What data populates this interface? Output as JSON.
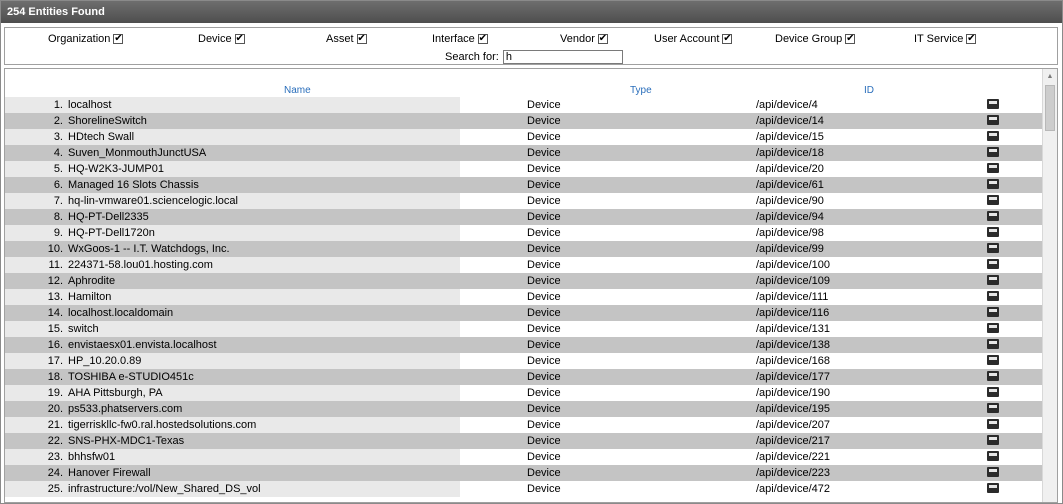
{
  "panel": {
    "title": "254 Entities Found"
  },
  "filters": [
    {
      "label": "Organization",
      "checked": true
    },
    {
      "label": "Device",
      "checked": true
    },
    {
      "label": "Asset",
      "checked": true
    },
    {
      "label": "Interface",
      "checked": true
    },
    {
      "label": "Vendor",
      "checked": true
    },
    {
      "label": "User Account",
      "checked": true
    },
    {
      "label": "Device Group",
      "checked": true
    },
    {
      "label": "IT Service",
      "checked": true
    }
  ],
  "check_glyph": "✔",
  "search": {
    "label": "Search for:",
    "value": "h"
  },
  "table": {
    "columns": {
      "name": "Name",
      "type": "Type",
      "id": "ID"
    },
    "rows": [
      {
        "num": "1.",
        "name": "localhost",
        "type": "Device",
        "id": "/api/device/4"
      },
      {
        "num": "2.",
        "name": "ShorelineSwitch",
        "type": "Device",
        "id": "/api/device/14"
      },
      {
        "num": "3.",
        "name": "HDtech Swall",
        "type": "Device",
        "id": "/api/device/15"
      },
      {
        "num": "4.",
        "name": "Suven_MonmouthJunctUSA",
        "type": "Device",
        "id": "/api/device/18"
      },
      {
        "num": "5.",
        "name": "HQ-W2K3-JUMP01",
        "type": "Device",
        "id": "/api/device/20"
      },
      {
        "num": "6.",
        "name": "Managed 16 Slots Chassis",
        "type": "Device",
        "id": "/api/device/61"
      },
      {
        "num": "7.",
        "name": "hq-lin-vmware01.sciencelogic.local",
        "type": "Device",
        "id": "/api/device/90"
      },
      {
        "num": "8.",
        "name": "HQ-PT-Dell2335",
        "type": "Device",
        "id": "/api/device/94"
      },
      {
        "num": "9.",
        "name": "HQ-PT-Dell1720n",
        "type": "Device",
        "id": "/api/device/98"
      },
      {
        "num": "10.",
        "name": "WxGoos-1 -- I.T. Watchdogs, Inc.",
        "type": "Device",
        "id": "/api/device/99"
      },
      {
        "num": "11.",
        "name": "224371-58.lou01.hosting.com",
        "type": "Device",
        "id": "/api/device/100"
      },
      {
        "num": "12.",
        "name": "Aphrodite",
        "type": "Device",
        "id": "/api/device/109"
      },
      {
        "num": "13.",
        "name": "Hamilton",
        "type": "Device",
        "id": "/api/device/111"
      },
      {
        "num": "14.",
        "name": "localhost.localdomain",
        "type": "Device",
        "id": "/api/device/116"
      },
      {
        "num": "15.",
        "name": "switch",
        "type": "Device",
        "id": "/api/device/131"
      },
      {
        "num": "16.",
        "name": "envistaesx01.envista.localhost",
        "type": "Device",
        "id": "/api/device/138"
      },
      {
        "num": "17.",
        "name": "HP_10.20.0.89",
        "type": "Device",
        "id": "/api/device/168"
      },
      {
        "num": "18.",
        "name": "TOSHIBA e-STUDIO451c",
        "type": "Device",
        "id": "/api/device/177"
      },
      {
        "num": "19.",
        "name": "AHA Pittsburgh, PA",
        "type": "Device",
        "id": "/api/device/190"
      },
      {
        "num": "20.",
        "name": "ps533.phatservers.com",
        "type": "Device",
        "id": "/api/device/195"
      },
      {
        "num": "21.",
        "name": "tigerriskllc-fw0.ral.hostedsolutions.com",
        "type": "Device",
        "id": "/api/device/207"
      },
      {
        "num": "22.",
        "name": "SNS-PHX-MDC1-Texas",
        "type": "Device",
        "id": "/api/device/217"
      },
      {
        "num": "23.",
        "name": "bhhsfw01",
        "type": "Device",
        "id": "/api/device/221"
      },
      {
        "num": "24.",
        "name": "Hanover Firewall",
        "type": "Device",
        "id": "/api/device/223"
      },
      {
        "num": "25.",
        "name": "infrastructure:/vol/New_Shared_DS_vol",
        "type": "Device",
        "id": "/api/device/472"
      }
    ]
  }
}
